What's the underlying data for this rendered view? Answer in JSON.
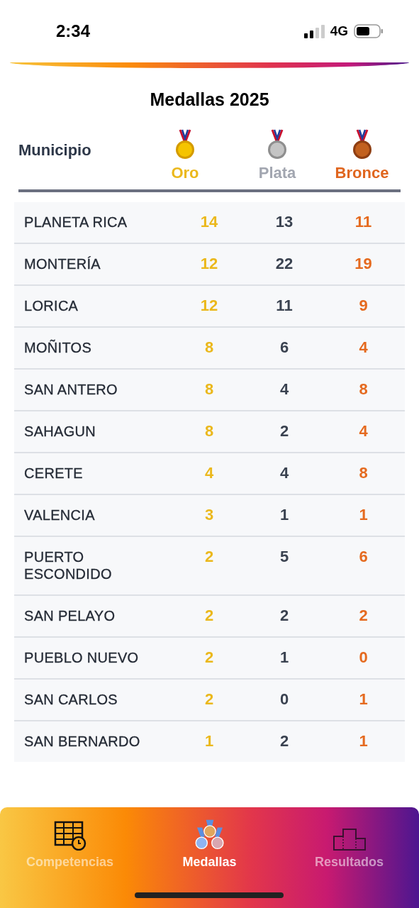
{
  "status_bar": {
    "time": "2:34",
    "network": "4G"
  },
  "title": "Medallas 2025",
  "table": {
    "columns": [
      {
        "label": "Municipio",
        "kind": "name"
      },
      {
        "label": "Oro",
        "kind": "gold"
      },
      {
        "label": "Plata",
        "kind": "silver"
      },
      {
        "label": "Bronce",
        "kind": "bronze"
      }
    ],
    "rows": [
      {
        "municipio": "PLANETA RICA",
        "oro": "14",
        "plata": "13",
        "bronce": "11"
      },
      {
        "municipio": "MONTERÍA",
        "oro": "12",
        "plata": "22",
        "bronce": "19"
      },
      {
        "municipio": "LORICA",
        "oro": "12",
        "plata": "11",
        "bronce": "9"
      },
      {
        "municipio": "MOÑITOS",
        "oro": "8",
        "plata": "6",
        "bronce": "4"
      },
      {
        "municipio": "SAN ANTERO",
        "oro": "8",
        "plata": "4",
        "bronce": "8"
      },
      {
        "municipio": "SAHAGUN",
        "oro": "8",
        "plata": "2",
        "bronce": "4"
      },
      {
        "municipio": "CERETE",
        "oro": "4",
        "plata": "4",
        "bronce": "8"
      },
      {
        "municipio": "VALENCIA",
        "oro": "3",
        "plata": "1",
        "bronce": "1"
      },
      {
        "municipio": "PUERTO ESCONDIDO",
        "oro": "2",
        "plata": "5",
        "bronce": "6"
      },
      {
        "municipio": "SAN PELAYO",
        "oro": "2",
        "plata": "2",
        "bronce": "2"
      },
      {
        "municipio": "PUEBLO NUEVO",
        "oro": "2",
        "plata": "1",
        "bronce": "0"
      },
      {
        "municipio": "SAN CARLOS",
        "oro": "2",
        "plata": "0",
        "bronce": "1"
      },
      {
        "municipio": "SAN BERNARDO",
        "oro": "1",
        "plata": "2",
        "bronce": "1"
      }
    ]
  },
  "tabs": [
    {
      "label": "Competencias",
      "kind": "schedule",
      "selected": false
    },
    {
      "label": "Medallas",
      "kind": "medals",
      "selected": true
    },
    {
      "label": "Resultados",
      "kind": "podium",
      "selected": false
    }
  ]
}
